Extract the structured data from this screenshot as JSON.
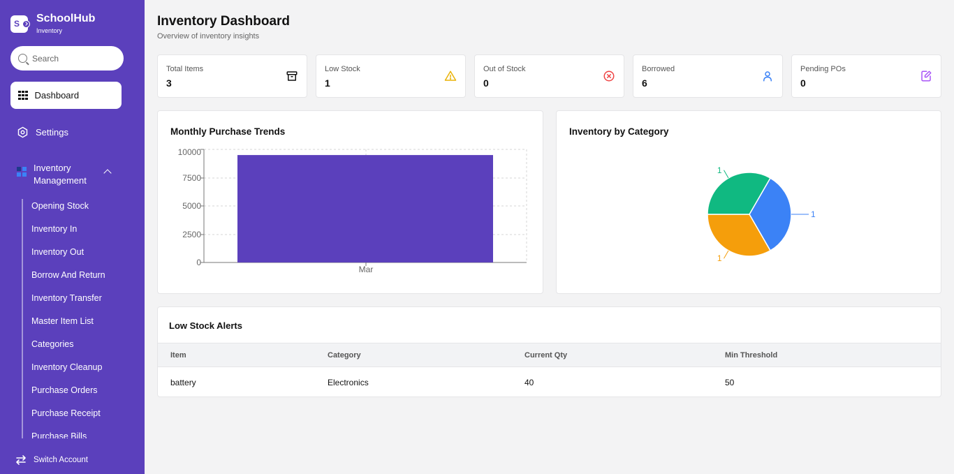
{
  "brand": {
    "name": "SchoolHub",
    "sub": "Inventory",
    "logo_letter": "S"
  },
  "search": {
    "placeholder": "Search"
  },
  "nav": {
    "dashboard": "Dashboard",
    "settings": "Settings",
    "inventory_management": "Inventory Management",
    "sub_items": [
      "Opening Stock",
      "Inventory In",
      "Inventory Out",
      "Borrow And Return",
      "Inventory Transfer",
      "Master Item List",
      "Categories",
      "Inventory Cleanup",
      "Purchase Orders",
      "Purchase Receipt",
      "Purchase Bills"
    ],
    "switch_account": "Switch Account"
  },
  "header": {
    "title": "Inventory Dashboard",
    "subtitle": "Overview of inventory insights"
  },
  "stats": [
    {
      "label": "Total Items",
      "value": "3",
      "icon": "archive-icon",
      "color": "#111111"
    },
    {
      "label": "Low Stock",
      "value": "1",
      "icon": "warning-icon",
      "color": "#eab308"
    },
    {
      "label": "Out of Stock",
      "value": "0",
      "icon": "x-circle-icon",
      "color": "#ef4444"
    },
    {
      "label": "Borrowed",
      "value": "6",
      "icon": "user-icon",
      "color": "#3b82f6"
    },
    {
      "label": "Pending POs",
      "value": "0",
      "icon": "edit-icon",
      "color": "#a855f7"
    }
  ],
  "purchase_chart": {
    "title": "Monthly Purchase Trends",
    "y_ticks": [
      "10000",
      "7500",
      "5000",
      "2500",
      "0"
    ],
    "x_ticks": [
      "Mar"
    ]
  },
  "category_chart": {
    "title": "Inventory by Category",
    "labels": [
      "1",
      "1",
      "1"
    ]
  },
  "chart_data": [
    {
      "type": "bar",
      "title": "Monthly Purchase Trends",
      "categories": [
        "Mar"
      ],
      "values": [
        9500
      ],
      "ylim": [
        0,
        10000
      ],
      "grid": true,
      "color": "#5b40bc"
    },
    {
      "type": "pie",
      "title": "Inventory by Category",
      "values": [
        1,
        1,
        1
      ],
      "colors": [
        "#3b82f6",
        "#f59e0b",
        "#10b981"
      ]
    }
  ],
  "low_stock": {
    "title": "Low Stock Alerts",
    "columns": [
      "Item",
      "Category",
      "Current Qty",
      "Min Threshold"
    ],
    "rows": [
      [
        "battery",
        "Electronics",
        "40",
        "50"
      ]
    ]
  },
  "colors": {
    "sidebar": "#5b40bc",
    "bar": "#5b40bc",
    "background": "#f3f3f4"
  }
}
